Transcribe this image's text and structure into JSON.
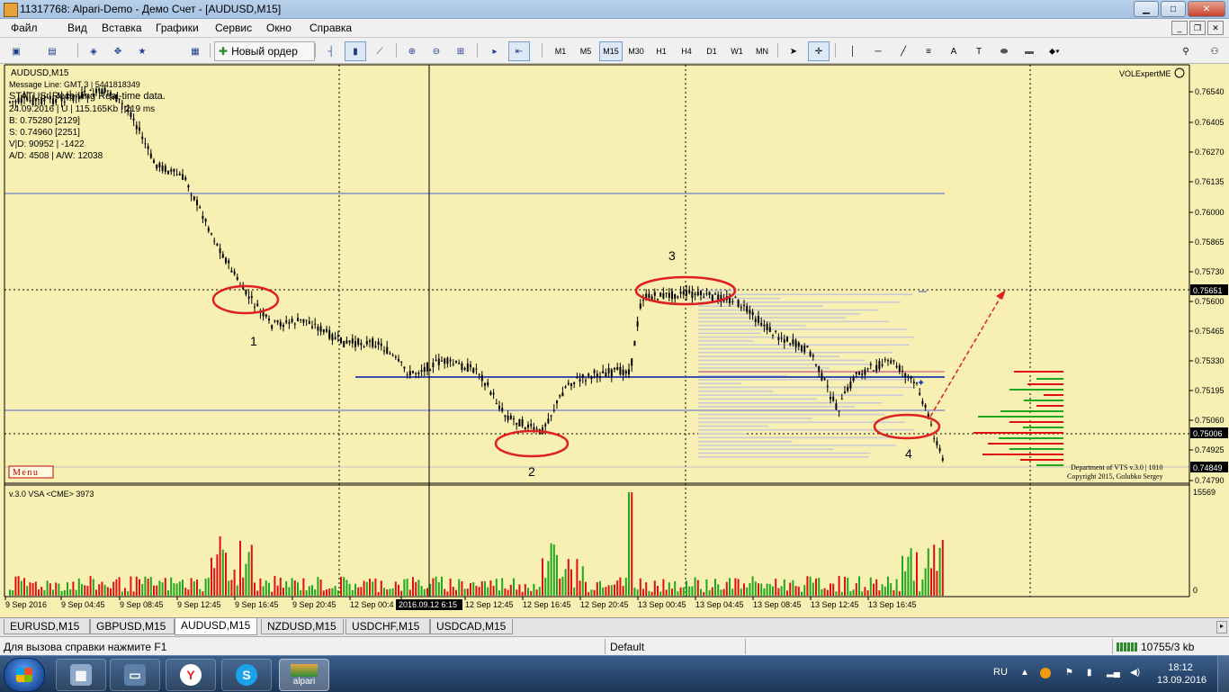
{
  "window": {
    "title": "11317768: Alpari-Demo - Демо Счет - [AUDUSD,M15]"
  },
  "menu": [
    "Файл",
    "Вид",
    "Вставка",
    "Графики",
    "Сервис",
    "Окно",
    "Справка"
  ],
  "toolbar": {
    "new_order_label": "Новый ордер",
    "timeframes": [
      "M1",
      "M5",
      "M15",
      "M30",
      "H1",
      "H4",
      "D1",
      "W1",
      "MN"
    ],
    "active_timeframe": "M15"
  },
  "chart": {
    "symbol_label": "AUDUSD,M15",
    "info_lines": [
      "Message Line: GMT 3 | 5441818349",
      "STATUS: Receiving Real-time data.",
      "24.09.2016 | U | 115.165Kb | 219 ms",
      "B: 0.75280  [2129]",
      "S: 0.74960  [2251]",
      "V|D: 90952 | -1422",
      "A/D: 4508 | A/W: 12038"
    ],
    "expert_label": "VOLExpertME",
    "menu_button": "Menu",
    "annotations": [
      "1",
      "2",
      "3",
      "4"
    ],
    "copyright_lines": [
      "Department of VTS  v.3.0 | 1010",
      "Copyright 2015, Golubko Sergey"
    ],
    "price_ticks": [
      "0.76540",
      "0.76405",
      "0.76270",
      "0.76135",
      "0.76000",
      "0.75865",
      "0.75730",
      "0.75600",
      "0.75465",
      "0.75330",
      "0.75195",
      "0.75060",
      "0.74925",
      "0.74790"
    ],
    "price_labels": {
      "upper": "0.75651",
      "middle": "0.75006",
      "bid": "0.74849"
    },
    "time_ticks": [
      "9 Sep 2016",
      "9 Sep 04:45",
      "9 Sep 08:45",
      "9 Sep 12:45",
      "9 Sep 16:45",
      "9 Sep 20:45",
      "12 Sep 00:4",
      "12 Sep 08:45",
      "12 Sep 12:45",
      "12 Sep 16:45",
      "12 Sep 20:45",
      "13 Sep 00:45",
      "13 Sep 04:45",
      "13 Sep 08:45",
      "13 Sep 12:45",
      "13 Sep 16:45"
    ],
    "crosshair_time_label": "2016.09.12 6:15",
    "sub_window": {
      "label": "v.3.0 VSA <CME> 3973",
      "scale_max": "15569",
      "scale_min": "0"
    },
    "colors": {
      "background": "#f7f0b2",
      "bull": "#1fa81f",
      "bear": "#e01010",
      "candle": "#000000",
      "ellipse": "#e02020",
      "level_line": "#3a50b0"
    }
  },
  "symbol_tabs": [
    "EURUSD,M15",
    "GBPUSD,M15",
    "AUDUSD,M15",
    "NZDUSD,M15",
    "USDCHF,M15",
    "USDCAD,M15"
  ],
  "active_symbol_tab": "AUDUSD,M15",
  "status": {
    "help": "Для вызова справки нажмите F1",
    "profile": "Default",
    "traffic": "10755/3 kb"
  },
  "taskbar": {
    "alpari_label": "alpari",
    "lang": "RU",
    "time": "18:12",
    "date": "13.09.2016"
  }
}
